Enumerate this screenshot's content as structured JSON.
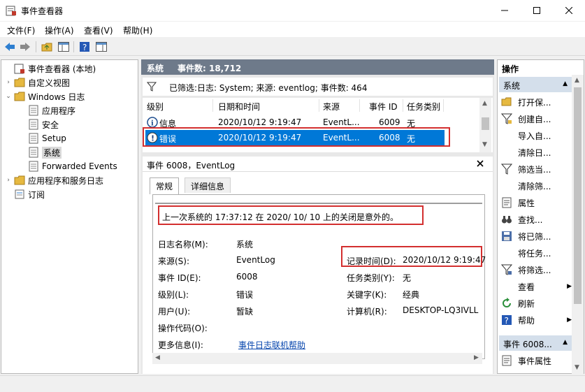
{
  "window": {
    "title": "事件查看器"
  },
  "menu": [
    "文件(F)",
    "操作(A)",
    "查看(V)",
    "帮助(H)"
  ],
  "tree": {
    "items": [
      {
        "label": "事件查看器 (本地)",
        "level": 0,
        "twisty": ""
      },
      {
        "label": "自定义视图",
        "level": 1,
        "twisty": "›"
      },
      {
        "label": "Windows 日志",
        "level": 1,
        "twisty": "⌄"
      },
      {
        "label": "应用程序",
        "level": 2,
        "twisty": ""
      },
      {
        "label": "安全",
        "level": 2,
        "twisty": ""
      },
      {
        "label": "Setup",
        "level": 2,
        "twisty": ""
      },
      {
        "label": "系统",
        "level": 2,
        "twisty": "",
        "selected": true
      },
      {
        "label": "Forwarded Events",
        "level": 2,
        "twisty": ""
      },
      {
        "label": "应用程序和服务日志",
        "level": 1,
        "twisty": "›"
      },
      {
        "label": "订阅",
        "level": 1,
        "twisty": ""
      }
    ]
  },
  "center": {
    "log_name": "系统",
    "event_count": "事件数: 18,712",
    "filter_text": "已筛选:日志: System; 来源: eventlog; 事件数: 464",
    "columns": [
      "级别",
      "日期和时间",
      "来源",
      "事件 ID",
      "任务类别"
    ],
    "rows": [
      {
        "level": "信息",
        "datetime": "2020/10/12 9:19:47",
        "source": "EventL...",
        "id": "6009",
        "task": "无",
        "icon": "info-icon"
      },
      {
        "level": "错误",
        "datetime": "2020/10/12 9:19:47",
        "source": "EventL...",
        "id": "6008",
        "task": "无",
        "icon": "error-icon",
        "selected": true
      }
    ]
  },
  "detail": {
    "header": "事件 6008，EventLog",
    "tabs": [
      "常规",
      "详细信息"
    ],
    "message": "上一次系统的 17:37:12 在    2020/    10/    10 上的关闭是意外的。",
    "fields": {
      "log_name_label": "日志名称(M):",
      "log_name_value": "系统",
      "source_label": "来源(S):",
      "source_value": "EventLog",
      "logged_label": "记录时间(D):",
      "logged_value": "2020/10/12 9:19:47",
      "event_id_label": "事件 ID(E):",
      "event_id_value": "6008",
      "task_label": "任务类别(Y):",
      "task_value": "无",
      "level_label": "级别(L):",
      "level_value": "错误",
      "keywords_label": "关键字(K):",
      "keywords_value": "经典",
      "user_label": "用户(U):",
      "user_value": "暂缺",
      "computer_label": "计算机(R):",
      "computer_value": "DESKTOP-LQ3IVLL",
      "opcode_label": "操作代码(O):",
      "more_info_label": "更多信息(I):",
      "more_info_link": "事件日志联机帮助"
    }
  },
  "actions": {
    "title": "操作",
    "section_log": "系统",
    "items_log": [
      {
        "label": "打开保...",
        "icon": "folder-open-icon"
      },
      {
        "label": "创建自...",
        "icon": "filter-icon"
      },
      {
        "label": "导入自...",
        "icon": ""
      },
      {
        "label": "清除日...",
        "icon": ""
      },
      {
        "label": "筛选当...",
        "icon": "filter-icon"
      },
      {
        "label": "清除筛...",
        "icon": ""
      },
      {
        "label": "属性",
        "icon": "properties-icon"
      },
      {
        "label": "查找...",
        "icon": "binoculars-icon"
      },
      {
        "label": "将已筛...",
        "icon": "save-icon"
      },
      {
        "label": "将任务...",
        "icon": ""
      },
      {
        "label": "将筛选...",
        "icon": "filter-icon"
      },
      {
        "label": "查看",
        "icon": "",
        "arrow": "▶"
      },
      {
        "label": "刷新",
        "icon": "refresh-icon"
      },
      {
        "label": "帮助",
        "icon": "help-icon",
        "arrow": "▶"
      }
    ],
    "section_event": "事件 6008...",
    "items_event": [
      {
        "label": "事件属性",
        "icon": "properties-icon"
      }
    ]
  }
}
